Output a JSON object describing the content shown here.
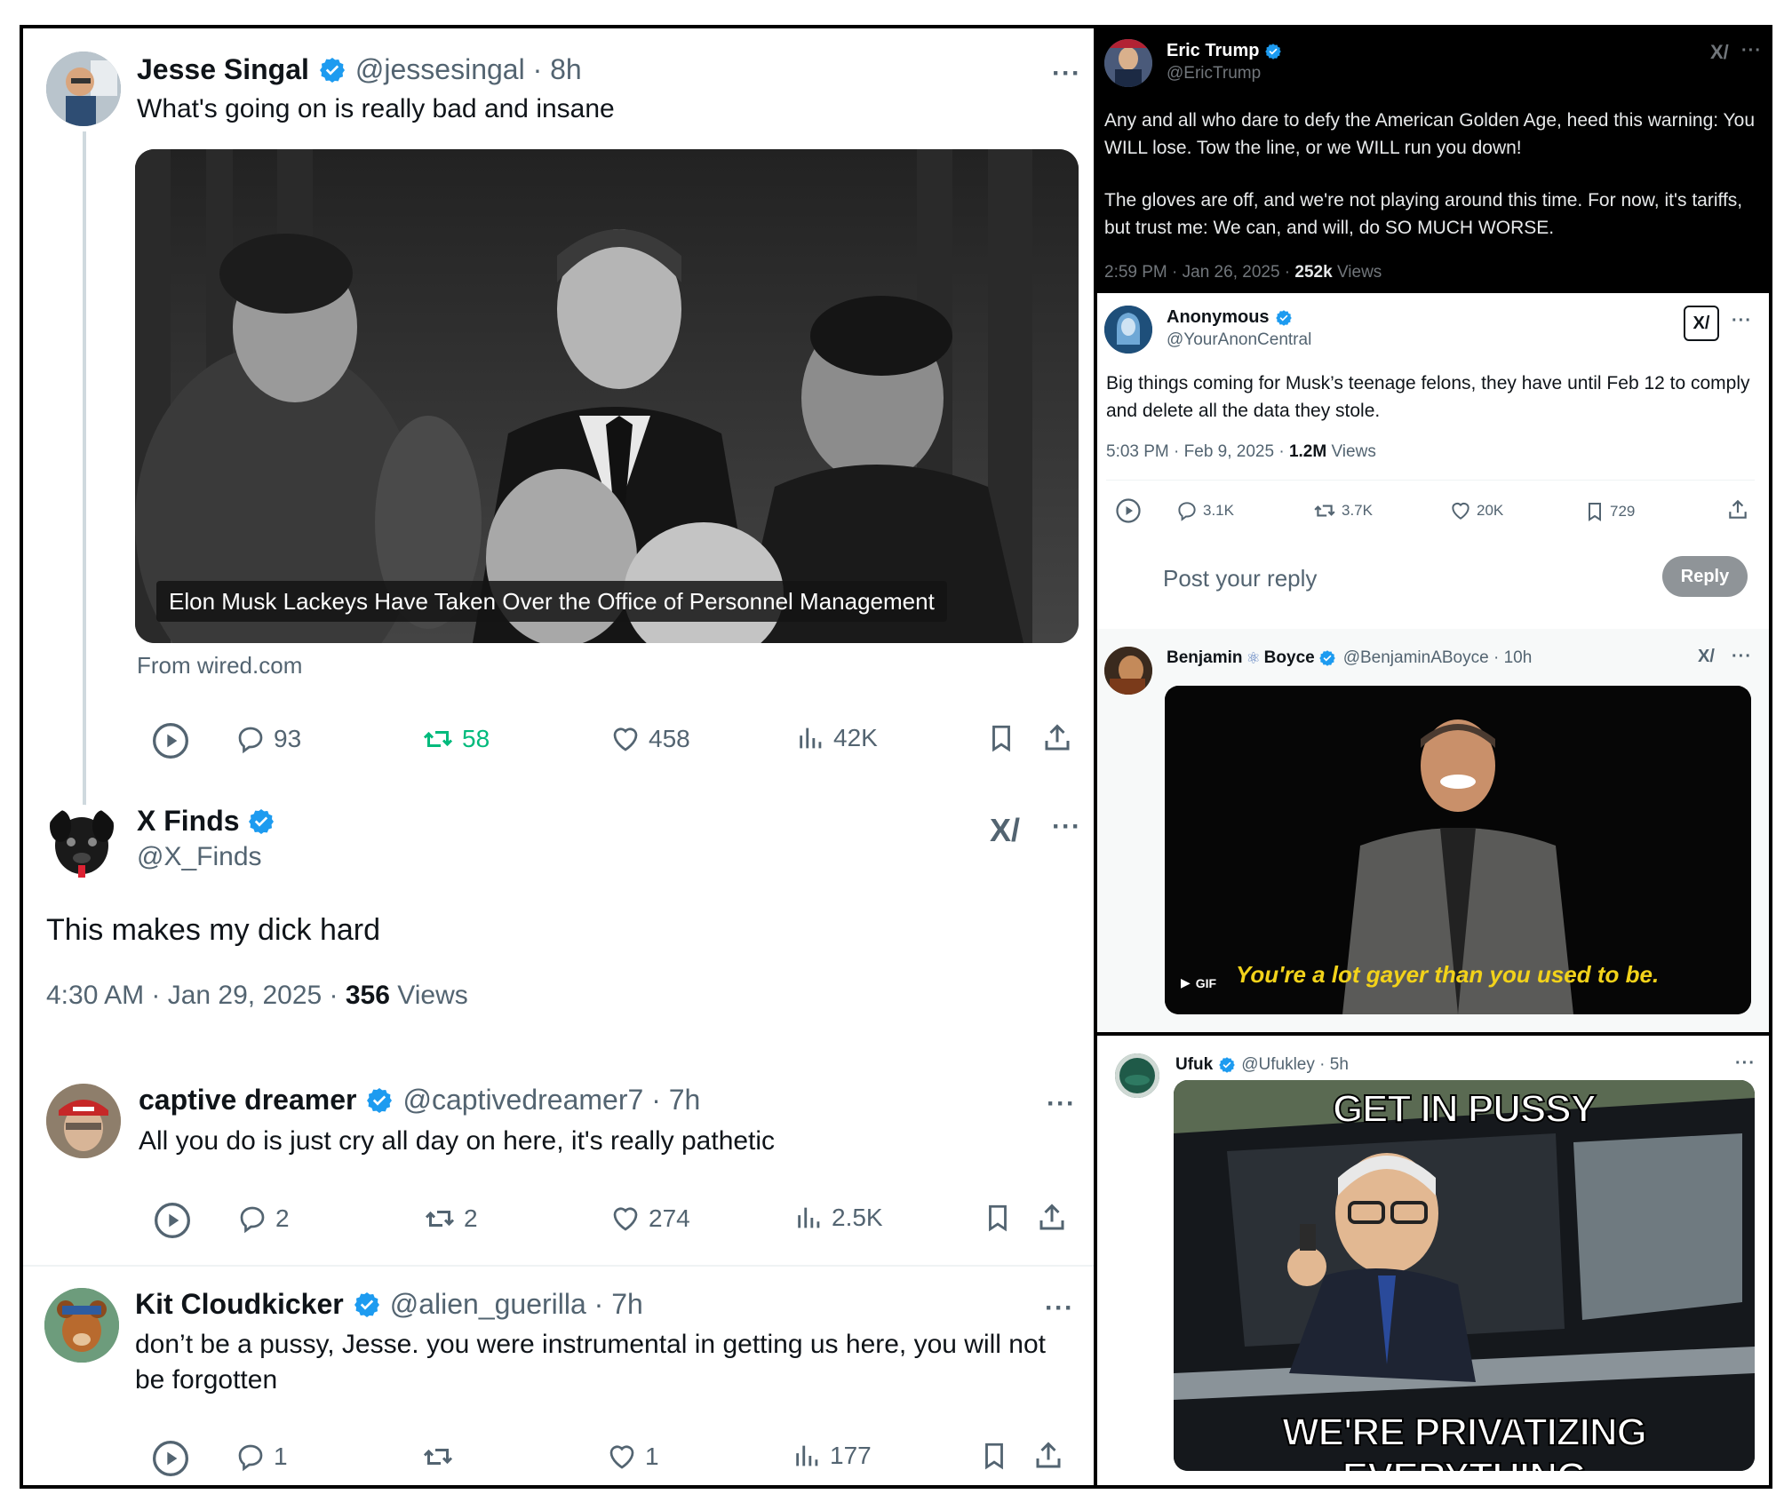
{
  "left": {
    "tweet1": {
      "name": "Jesse Singal",
      "handle": "@jessesingal · 8h",
      "text": "What's going on is really bad and insane",
      "image_caption": "Elon Musk Lackeys Have Taken Over the Office of Personnel Management",
      "source": "From wired.com",
      "replies": "93",
      "reposts": "58",
      "likes": "458",
      "views": "42K"
    },
    "tweet2": {
      "name": "X Finds",
      "handle": "@X_Finds",
      "text": "This makes my dick hard",
      "time": "4:30 AM · Jan 29, 2025 · ",
      "views_count": "356",
      "views_label": " Views"
    },
    "tweet3": {
      "name": "captive dreamer",
      "handle": "@captivedreamer7 · 7h",
      "text": "All you do is just cry all day on here, it's really pathetic",
      "replies": "2",
      "reposts": "2",
      "likes": "274",
      "views": "2.5K"
    },
    "tweet4": {
      "name": "Kit Cloudkicker",
      "handle": "@alien_guerilla · 7h",
      "text": "don’t be a pussy, Jesse. you were instrumental in getting us here, you will not be forgotten",
      "replies": "1",
      "reposts": "",
      "likes": "1",
      "views": "177"
    }
  },
  "right": {
    "tweet1": {
      "name": "Eric Trump",
      "handle": "@EricTrump",
      "text1": "Any and all who dare to defy the American Golden Age, heed this warning: You WILL lose. Tow the line, or we WILL run you down!",
      "text2": "The gloves are off, and we're not playing around this time. For now, it's tariffs, but trust me: We can, and will, do SO MUCH WORSE.",
      "time": "2:59 PM · Jan 26, 2025 · ",
      "views_count": "252k",
      "views_label": " Views"
    },
    "tweet2": {
      "name": "Anonymous",
      "handle": "@YourAnonCentral",
      "text": "Big things coming for Musk’s teenage felons, they have until Feb 12 to comply and delete all the data they stole.",
      "time": "5:03 PM · Feb 9, 2025 · ",
      "views_count": "1.2M",
      "views_label": " Views",
      "replies": "3.1K",
      "reposts": "3.7K",
      "likes": "20K",
      "bookmarks": "729",
      "reply_placeholder": "Post your reply",
      "reply_button": "Reply"
    },
    "tweet3": {
      "name_a": "Benjamin",
      "name_b": "Boyce",
      "handle": "@BenjaminABoyce · 10h",
      "gif_caption": "You're a lot gayer than you used to be.",
      "gif_badge": "GIF"
    },
    "tweet4": {
      "name": "Ufuk",
      "handle": "@Ufukley · 5h",
      "meme_top": "GET IN PUSSY",
      "meme_bottom": "WE'RE PRIVATIZING EVERYTHING"
    }
  },
  "colors": {
    "verified": "#1d9bf0",
    "repost_active": "#00ba7c",
    "muted": "#536471",
    "dark_bg": "#000000"
  }
}
